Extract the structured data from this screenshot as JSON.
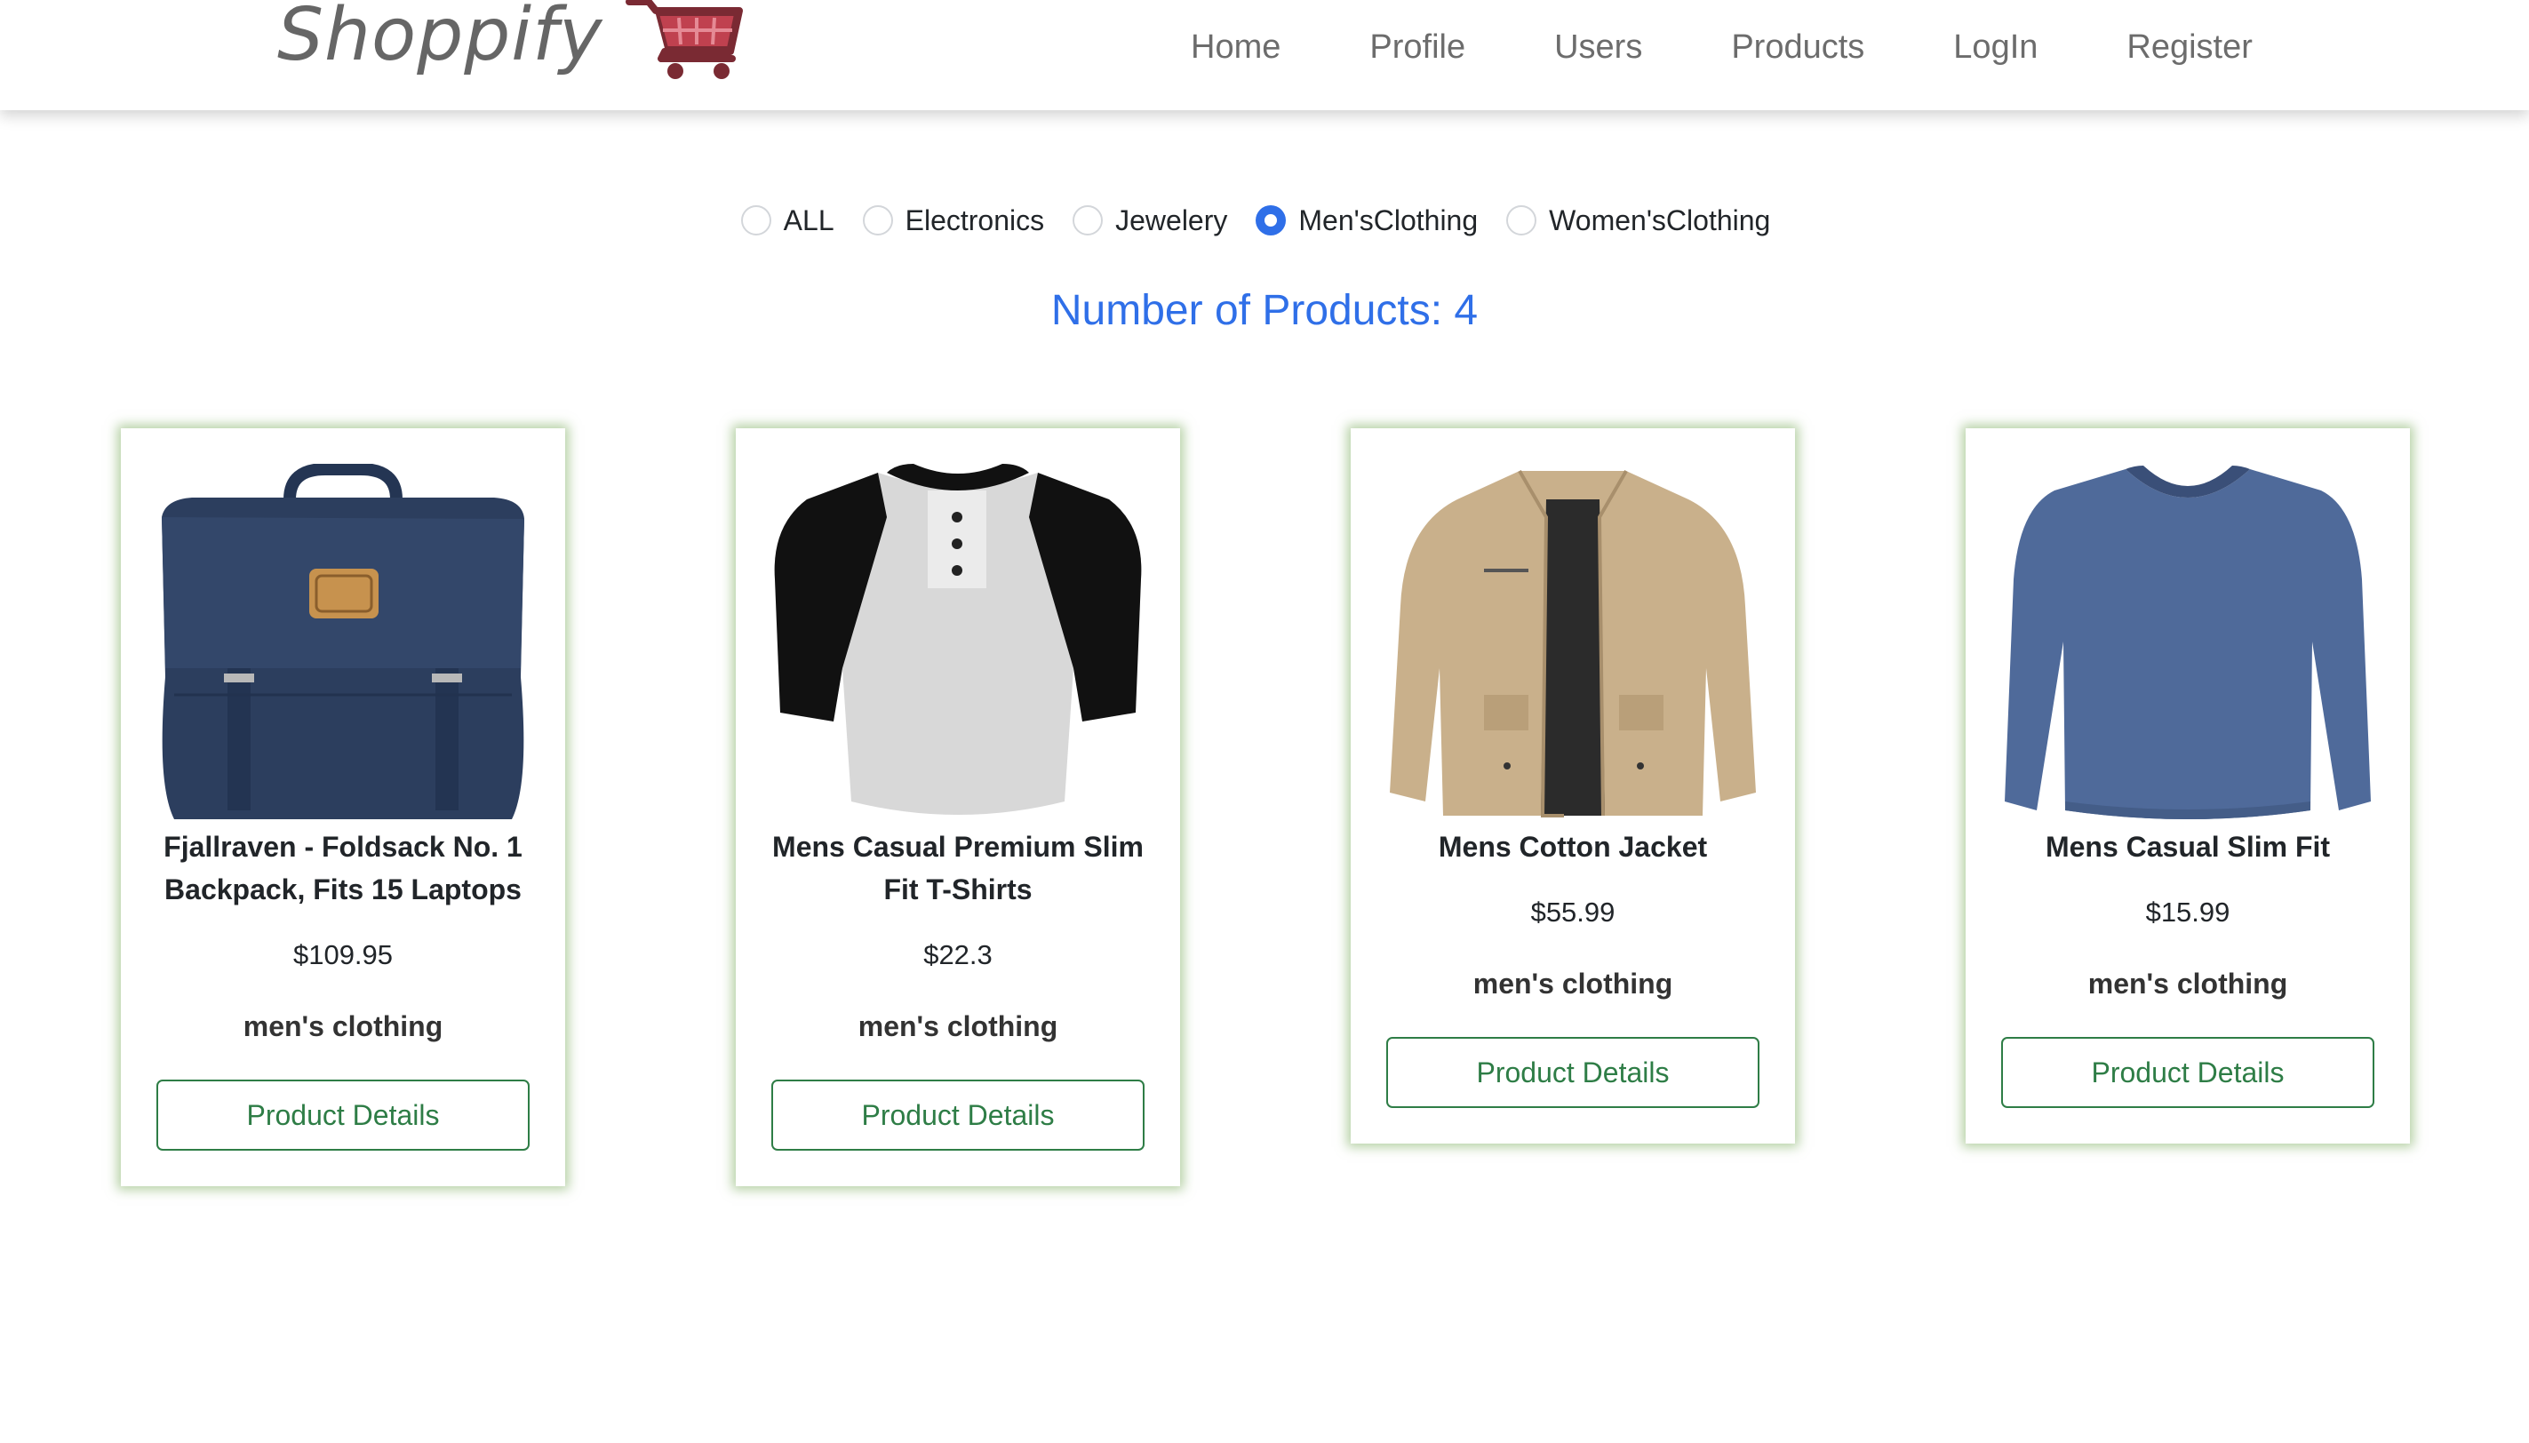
{
  "brand": {
    "name": "Shoppify",
    "icon": "cart-icon",
    "color": "#b23a48"
  },
  "nav": {
    "items": [
      "Home",
      "Profile",
      "Users",
      "Products",
      "LogIn",
      "Register"
    ]
  },
  "filters": {
    "options": [
      "ALL",
      "Electronics",
      "Jewelery",
      "Men'sClothing",
      "Women'sClothing"
    ],
    "selected": "Men'sClothing"
  },
  "products_count": "Number of Products: 4",
  "products": [
    {
      "title": "Fjallraven - Foldsack No. 1 Backpack, Fits 15 Laptops",
      "price": "$109.95",
      "category": "men's clothing",
      "button": "Product Details",
      "image": "backpack-image"
    },
    {
      "title": "Mens Casual Premium Slim Fit T-Shirts",
      "price": "$22.3",
      "category": "men's clothing",
      "button": "Product Details",
      "image": "raglan-tshirt-image"
    },
    {
      "title": "Mens Cotton Jacket",
      "price": "$55.99",
      "category": "men's clothing",
      "button": "Product Details",
      "image": "cotton-jacket-image"
    },
    {
      "title": "Mens Casual Slim Fit",
      "price": "$15.99",
      "category": "men's clothing",
      "button": "Product Details",
      "image": "longsleeve-shirt-image"
    }
  ],
  "colors": {
    "accent": "#2f6fe8",
    "button": "#2e7d46",
    "card_glow": "#78aa5a",
    "nav_text": "#6c6c6c"
  }
}
